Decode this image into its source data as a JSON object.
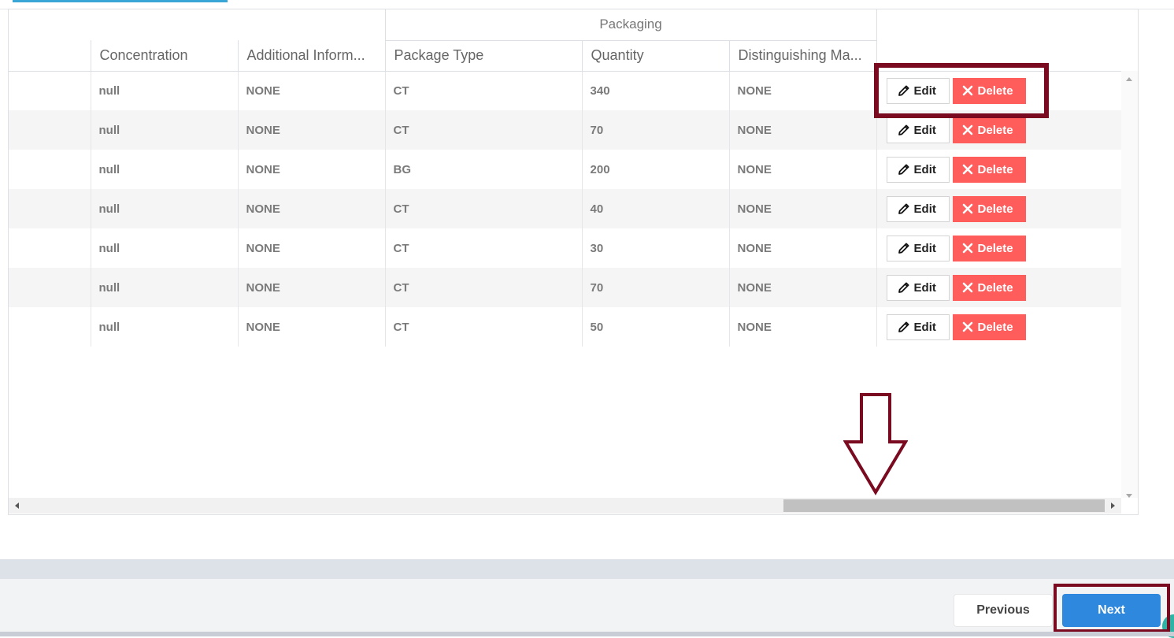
{
  "table": {
    "group_header": "Packaging",
    "columns": [
      "Concentration",
      "Additional Inform...",
      "Package Type",
      "Quantity",
      "Distinguishing Ma..."
    ],
    "rows": [
      {
        "concentration": "null",
        "additional_info": "NONE",
        "package_type": "CT",
        "quantity": "340",
        "distinguishing_marks": "NONE"
      },
      {
        "concentration": "null",
        "additional_info": "NONE",
        "package_type": "CT",
        "quantity": "70",
        "distinguishing_marks": "NONE"
      },
      {
        "concentration": "null",
        "additional_info": "NONE",
        "package_type": "BG",
        "quantity": "200",
        "distinguishing_marks": "NONE"
      },
      {
        "concentration": "null",
        "additional_info": "NONE",
        "package_type": "CT",
        "quantity": "40",
        "distinguishing_marks": "NONE"
      },
      {
        "concentration": "null",
        "additional_info": "NONE",
        "package_type": "CT",
        "quantity": "30",
        "distinguishing_marks": "NONE"
      },
      {
        "concentration": "null",
        "additional_info": "NONE",
        "package_type": "CT",
        "quantity": "70",
        "distinguishing_marks": "NONE"
      },
      {
        "concentration": "null",
        "additional_info": "NONE",
        "package_type": "CT",
        "quantity": "50",
        "distinguishing_marks": "NONE"
      }
    ],
    "edit_label": "Edit",
    "delete_label": "Delete"
  },
  "footer": {
    "previous_label": "Previous",
    "next_label": "Next"
  },
  "colors": {
    "delete_button": "#ff5c5c",
    "next_button": "#2e88dd",
    "annotation": "#7a0a20",
    "tab_indicator": "#3aa6d8"
  },
  "icons": {
    "edit": "pencil-icon",
    "delete": "x-icon"
  }
}
